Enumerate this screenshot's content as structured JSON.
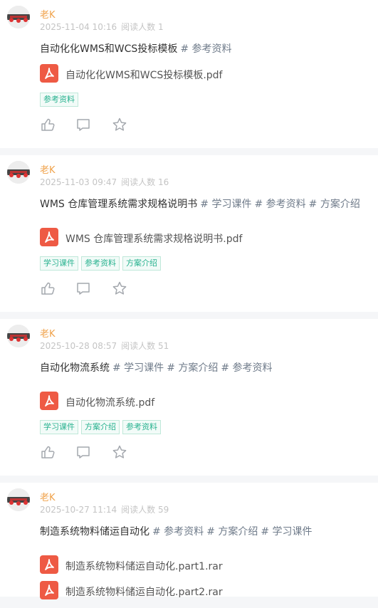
{
  "posts": [
    {
      "author": "老K",
      "date": "2025-11-04 10:16",
      "reads": "阅读人数 1",
      "title": "自动化化WMS和WCS投标模板",
      "tags": [
        "# 参考资料"
      ],
      "files": [
        {
          "name": "自动化化WMS和WCS投标模板.pdf",
          "icon": "pdf-file-icon"
        }
      ],
      "badges": [
        "参考资料"
      ]
    },
    {
      "author": "老K",
      "date": "2025-11-03 09:47",
      "reads": "阅读人数 16",
      "title": "WMS 仓库管理系统需求规格说明书",
      "tags": [
        "# 学习课件",
        "# 参考资料",
        "# 方案介绍"
      ],
      "files": [
        {
          "name": "WMS 仓库管理系统需求规格说明书.pdf",
          "icon": "pdf-file-icon"
        }
      ],
      "badges": [
        "学习课件",
        "参考资料",
        "方案介绍"
      ]
    },
    {
      "author": "老K",
      "date": "2025-10-28 08:57",
      "reads": "阅读人数 51",
      "title": "自动化物流系统",
      "tags": [
        "# 学习课件",
        "# 方案介绍",
        "# 参考资料"
      ],
      "files": [
        {
          "name": "自动化物流系统.pdf",
          "icon": "pdf-file-icon"
        }
      ],
      "badges": [
        "学习课件",
        "方案介绍",
        "参考资料"
      ]
    },
    {
      "author": "老K",
      "date": "2025-10-27 11:14",
      "reads": "阅读人数 59",
      "title": "制造系统物料储运自动化",
      "tags": [
        "# 参考资料",
        "# 方案介绍",
        "# 学习课件"
      ],
      "files": [
        {
          "name": "制造系统物料储运自动化.part1.rar",
          "icon": "pdf-file-icon"
        },
        {
          "name": "制造系统物料储运自动化.part2.rar",
          "icon": "pdf-file-icon"
        }
      ],
      "badges": []
    }
  ],
  "colors": {
    "author": "#f0a24a",
    "badge": "#28b28f",
    "pdf_icon": "#ee5a44"
  },
  "icons": {
    "like": "thumbs-up-icon",
    "comment": "comment-icon",
    "star": "star-icon"
  }
}
